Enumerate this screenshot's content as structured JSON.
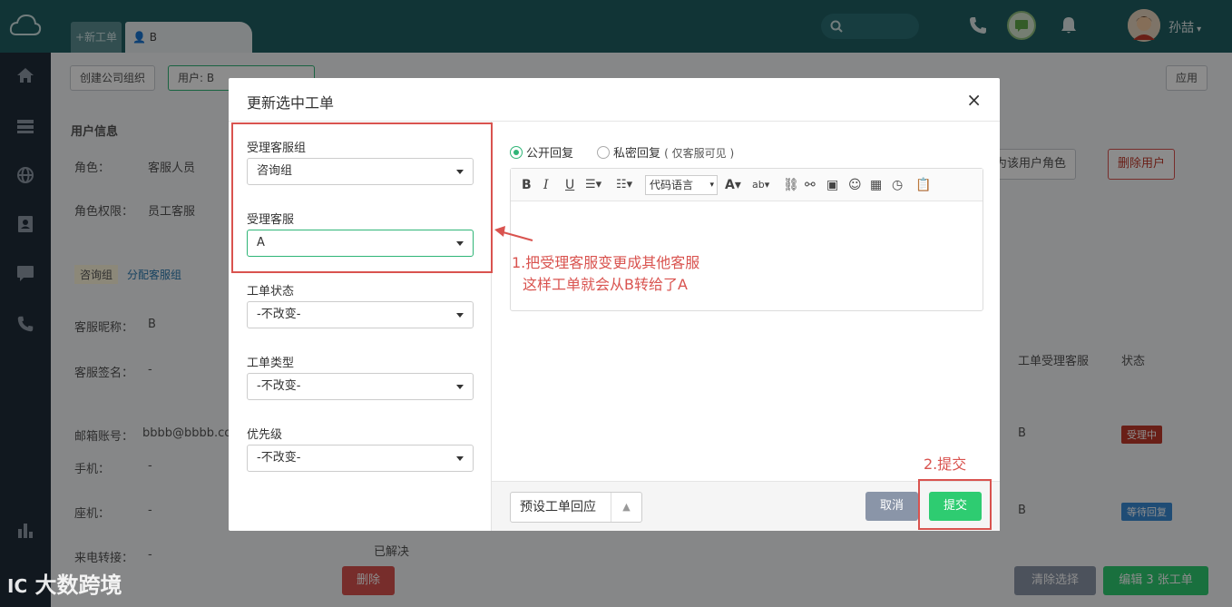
{
  "topbar": {
    "tab_new": "+新工单",
    "tab_b": "B",
    "user_name": "孙喆"
  },
  "page": {
    "btn_create_org": "创建公司组织",
    "btn_user_label": "用户: B",
    "btn_apply": "应用",
    "user_info_title": "用户信息",
    "role_label": "角色：",
    "role_value": "客服人员",
    "perm_label": "角色权限：",
    "perm_value": "员工客服",
    "group_tag": "咨询组",
    "assign_link": "分配客服组",
    "nick_label": "客服昵称：",
    "nick_value": "B",
    "sign_label": "客服签名：",
    "sign_value": "-",
    "email_label": "邮箱账号：",
    "email_value": "bbbb@bbbb.co",
    "phone_label": "手机：",
    "phone_value": "-",
    "tel_label": "座机：",
    "tel_value": "-",
    "transfer_label": "来电转接：",
    "transfer_value": "-",
    "btn_set_role": "为该用户角色",
    "btn_delete_user": "删除用户",
    "col_agent": "工单受理客服",
    "col_status": "状态",
    "row1_agent": "B",
    "row1_status": "受理中",
    "row2_agent": "B",
    "row2_status": "等待回复",
    "resolved_text": "已解决",
    "btn_delete": "删除",
    "btn_clear": "清除选择",
    "btn_edit": "编辑 3 张工单"
  },
  "modal": {
    "title": "更新选中工单",
    "close": "×",
    "group_label": "受理客服组",
    "group_value": "咨询组",
    "agent_label": "受理客服",
    "agent_value": "A",
    "status_label": "工单状态",
    "status_value": "-不改变-",
    "type_label": "工单类型",
    "type_value": "-不改变-",
    "priority_label": "优先级",
    "priority_value": "-不改变-",
    "radio_public": "公开回复",
    "radio_private": "私密回复",
    "radio_private_note": "( 仅客服可见 )",
    "code_lang": "代码语言",
    "preset_label": "预设工单回应",
    "cancel_label": "取消",
    "submit_label": "提交"
  },
  "annotations": {
    "note1_line1": "1.把受理客服变更成其他客服",
    "note1_line2": "这样工单就会从B转给了A",
    "note2": "2.提交"
  },
  "watermark": "大数跨境",
  "colors": {
    "topbar": "#1f5f63",
    "sidebar": "#202c3a",
    "accent_green": "#2ecc71",
    "annotation_red": "#d9534f",
    "cancel_gray": "#8a95a8"
  }
}
